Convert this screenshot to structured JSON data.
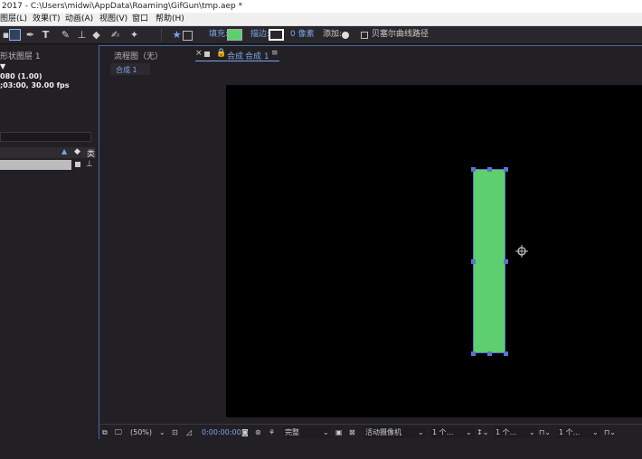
{
  "window": {
    "title": "2017 - C:\\Users\\midwi\\AppData\\Roaming\\GifGun\\tmp.aep *"
  },
  "menu": [
    "图层(L)",
    "效果(T)",
    "动画(A)",
    "视图(V)",
    "窗口",
    "帮助(H)"
  ],
  "toolbar": {
    "fill_label": "填充:",
    "stroke_label": "描边:",
    "stroke_width": "0 像素",
    "add_label": "添加:",
    "bezier_label": "贝塞尔曲线路径",
    "fill_color": "#5ecf6e",
    "stroke_color": "#ffffff"
  },
  "left_panel": {
    "title": "形状图层 1",
    "line1": "080 (1.00)",
    "line2": ";03:00, 30.00 fps",
    "header_type": "类"
  },
  "comp_panel": {
    "flowchart_tab": "流程图（无）",
    "tab_prefix": "合成",
    "tab_name": "合成 1",
    "breadcrumb": "合成 1"
  },
  "viewer": {
    "bg_color": "#000000",
    "shape_color": "#5ecf6e"
  },
  "bottom_bar": {
    "zoom": "(50%)",
    "timecode": "0:00:00:00",
    "resolution": "完整",
    "camera": "活动摄像机",
    "view1": "1 个...",
    "view2": "1 个...",
    "view3": "1 个..."
  }
}
